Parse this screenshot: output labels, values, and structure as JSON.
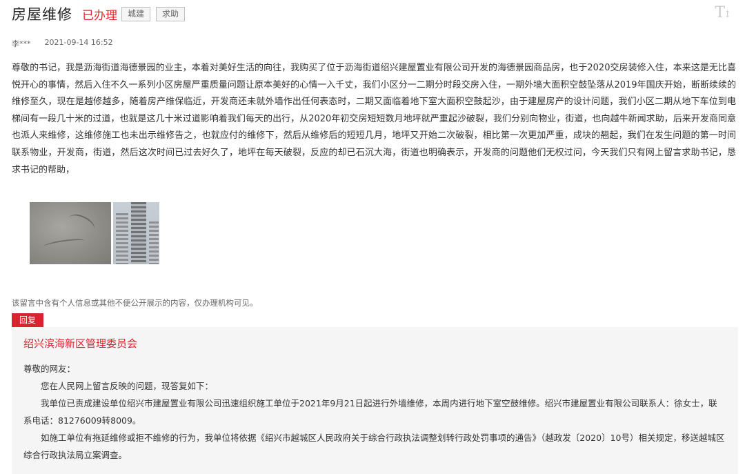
{
  "header": {
    "title": "房屋维修",
    "status": "已办理",
    "tags": [
      "城建",
      "求助"
    ],
    "font_toggle": "T",
    "font_toggle_small": "↕"
  },
  "meta": {
    "author": "李***",
    "datetime": "2021-09-14 16:52"
  },
  "message": {
    "body": "尊敬的书记，我是沥海街道海德景园的业主，本着对美好生活的向往，我购买了位于沥海街道绍兴建屋置业有限公司开发的海德景园商品房，也于2020交房装修入住，本来这是无比喜悦开心的事情，然后入住不久一系列小区房屋严重质量问题让原本美好的心情一入千丈，我们小区分一二期分时段交房入住，一期外墙大面积空鼓坠落从2019年国庆开始，断断续续的维修至久，现在是越修越多，随着房产维保临近，开发商还未就外墙作出任何表态时，二期又面临着地下室大面积空鼓起沙，由于建屋房产的设计问题，我们小区二期从地下车位到电梯间有一段几十米的过道，也就是这几十米过道影响着我们每天的出行，从2020年初交房短短数月地坪就严重起沙破裂，我们分别向物业，街道，也向越牛新闻求助，后来开发商同意也派人来维修，这维修施工也未出示维修告之，也就应付的维修下，然后从维修后的短短几月，地坪又开始二次破裂，相比第一次更加严重，成块的翘起，我们在发生问题的第一时间联系物业，开发商，街道，然后这次时间已过去好久了，地坪在每天破裂，反应的却已石沉大海，街道也明确表示，开发商的问题他们无权过问，今天我们只有网上留言求助书记，恳求书记的帮助，"
  },
  "notice": "该留言中含有个人信息或其他不便公开展示的内容，仅办理机构可见。",
  "reply": {
    "label": "回复",
    "org": "绍兴滨海新区管理委员会",
    "greeting": "尊敬的网友：",
    "p1": "您在人民网上留言反映的问题，现答复如下：",
    "p2": "我单位已责成建设单位绍兴市建屋置业有限公司迅速组织施工单位于2021年9月21日起进行外墙维修，本周内进行地下室空鼓维修。绍兴市建屋置业有限公司联系人：徐女士，联系电话：81276009转8009。",
    "p3": "如施工单位有拖延维修或拒不维修的行为，我单位将依据《绍兴市越城区人民政府关于综合行政执法调整划转行政处罚事项的通告》（越政发〔2020〕10号）相关规定，移送越城区综合行政执法局立案调查。"
  }
}
